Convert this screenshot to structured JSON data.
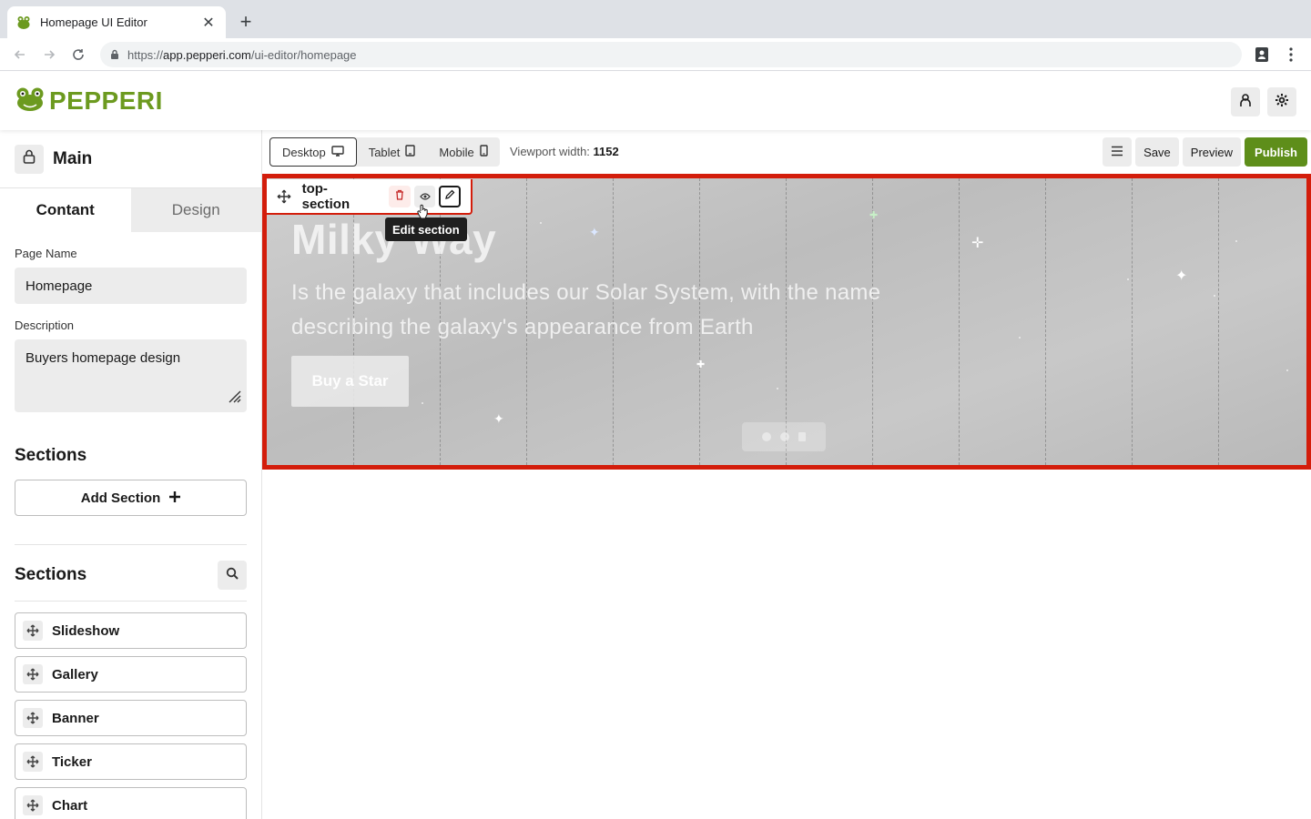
{
  "browser": {
    "tab_title": "Homepage UI Editor",
    "url_prefix": "https://",
    "url_host": "app.pepperi.com",
    "url_path": "/ui-editor/homepage"
  },
  "header": {
    "logo_text": "PEPPERI",
    "brand_color": "#6c9a1f"
  },
  "sidebar": {
    "title": "Main",
    "tabs": [
      {
        "label": "Contant",
        "active": true
      },
      {
        "label": "Design",
        "active": false
      }
    ],
    "page_name_label": "Page Name",
    "page_name_value": "Homepage",
    "description_label": "Description",
    "description_value": "Buyers homepage design",
    "add_heading": "Sections",
    "add_section_label": "Add Section",
    "list_heading": "Sections",
    "sections": [
      {
        "label": "Slideshow"
      },
      {
        "label": "Gallery"
      },
      {
        "label": "Banner"
      },
      {
        "label": "Ticker"
      },
      {
        "label": "Chart"
      }
    ]
  },
  "editor_toolbar": {
    "devices": [
      {
        "label": "Desktop",
        "icon": "desktop-icon",
        "active": true
      },
      {
        "label": "Tablet",
        "icon": "tablet-icon",
        "active": false
      },
      {
        "label": "Mobile",
        "icon": "mobile-icon",
        "active": false
      }
    ],
    "viewport_label": "Viewport width:",
    "viewport_value": "1152",
    "save_label": "Save",
    "preview_label": "Preview",
    "publish_label": "Publish",
    "publish_color": "#5e8e1a"
  },
  "section": {
    "name": "top-section",
    "tooltip": "Edit section",
    "highlight_color": "#d31d0b",
    "hero_title": "Milky Way",
    "hero_description": "Is the galaxy that includes our Solar System, with the name describing the galaxy's appearance from Earth",
    "hero_button": "Buy a Star"
  }
}
